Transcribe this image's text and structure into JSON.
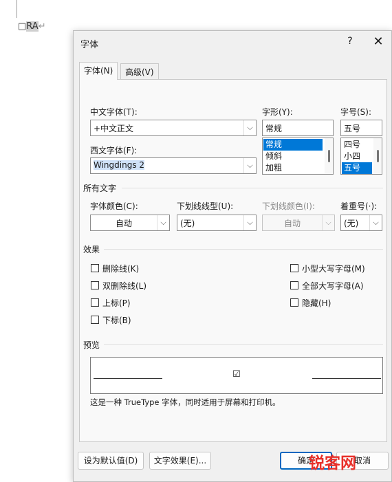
{
  "document": {
    "before": "□",
    "text": "RA",
    "mark": "↵"
  },
  "dialog": {
    "title": "字体",
    "help": "?",
    "close": "✕",
    "tabs": [
      {
        "label": "字体(N)"
      },
      {
        "label": "高级(V)"
      }
    ],
    "chinese_font": {
      "label": "中文字体(T):",
      "value": "+中文正文"
    },
    "western_font": {
      "label": "西文字体(F):",
      "value": "Wingdings 2"
    },
    "style": {
      "label": "字形(Y):",
      "value": "常规",
      "options": [
        "常规",
        "倾斜",
        "加粗"
      ]
    },
    "size": {
      "label": "字号(S):",
      "value": "五号",
      "options": [
        "四号",
        "小四",
        "五号"
      ]
    },
    "all_text": {
      "heading": "所有文字",
      "font_color": {
        "label": "字体颜色(C):",
        "value": "自动"
      },
      "underline_style": {
        "label": "下划线线型(U):",
        "value": "(无)"
      },
      "underline_color": {
        "label": "下划线颜色(I):",
        "value": "自动"
      },
      "emphasis": {
        "label": "着重号(·):",
        "value": "(无)"
      }
    },
    "effects": {
      "heading": "效果",
      "left": [
        "删除线(K)",
        "双删除线(L)",
        "上标(P)",
        "下标(B)"
      ],
      "right": [
        "小型大写字母(M)",
        "全部大写字母(A)",
        "隐藏(H)"
      ]
    },
    "preview": {
      "heading": "预览",
      "glyph": "☑",
      "note": "这是一种 TrueType 字体，同时适用于屏幕和打印机。"
    },
    "buttons": {
      "set_default": "设为默认值(D)",
      "text_effects": "文字效果(E)...",
      "ok": "确定",
      "cancel": "取消"
    }
  },
  "watermark": {
    "text": "锐客网"
  }
}
